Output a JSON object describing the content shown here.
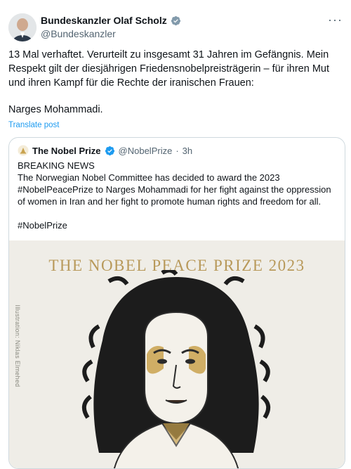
{
  "tweet": {
    "author": {
      "display_name": "Bundeskanzler Olaf Scholz",
      "handle": "@Bundeskanzler",
      "verified": true,
      "verified_color": "#829aab"
    },
    "more_icon": "more-horizontal-icon",
    "text": {
      "line1": "13 Mal verhaftet. Verurteilt zu insgesamt 31 Jahren im Gefängnis. Mein Respekt gilt der diesjährigen Friedensnobelpreisträgerin – für ihren Mut und ihren Kampf für die Rechte der iranischen Frauen:",
      "line2": "Narges Mohammadi."
    },
    "translate_label": "Translate post",
    "link_color": "#1d9bf0"
  },
  "quote": {
    "author": {
      "display_name": "The Nobel Prize",
      "handle": "@NobelPrize",
      "separator": "·",
      "time": "3h",
      "verified_color": "#1d9bf0"
    },
    "text": {
      "line1": "BREAKING NEWS",
      "line2": "The Norwegian Nobel Committee has decided to award the 2023 #NobelPeacePrize to Narges Mohammadi for her fight against the oppression of women in Iran and her fight to promote human rights and freedom for all.",
      "line3": "#NobelPrize"
    },
    "image": {
      "title": "THE NOBEL PEACE PRIZE 2023",
      "credit": "Illustration: Niklas Elmehed",
      "title_color": "#b8995a",
      "background_color": "#efede7"
    }
  }
}
